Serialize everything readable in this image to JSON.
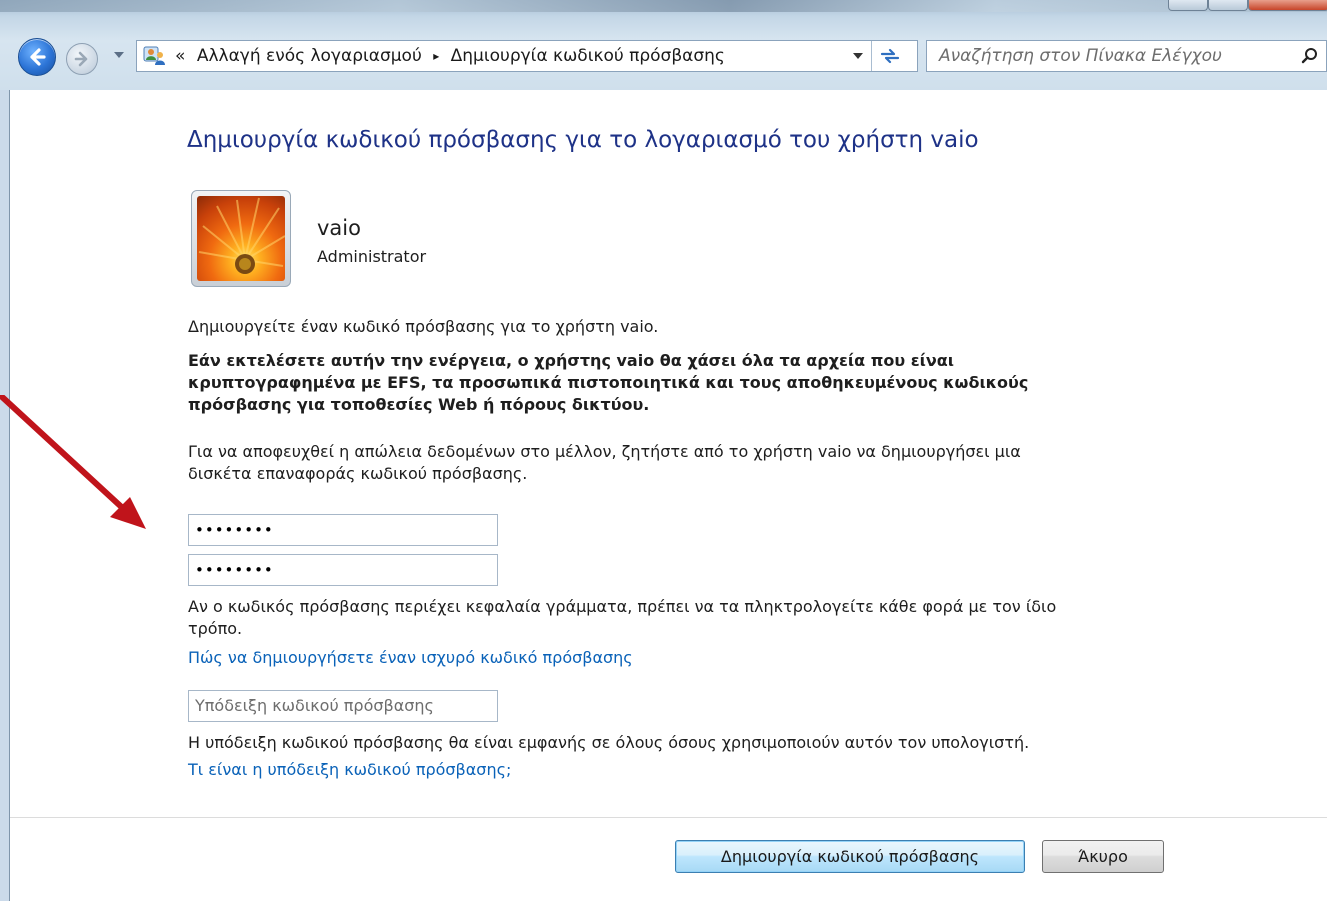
{
  "toolbar": {
    "breadcrumb": {
      "overflow": "«",
      "parent": "Αλλαγή ενός λογαριασμού",
      "separator": "▸",
      "current": "Δημιουργία κωδικού πρόσβασης"
    },
    "search_placeholder": "Αναζήτηση στον Πίνακα Ελέγχου"
  },
  "page": {
    "title": "Δημιουργία κωδικού πρόσβασης για το λογαριασμό του χρήστη vaio",
    "user": {
      "name": "vaio",
      "role": "Administrator"
    },
    "intro": "Δημιουργείτε έναν κωδικό πρόσβασης για το χρήστη vaio.",
    "warning_lines": [
      "Εάν εκτελέσετε αυτήν την ενέργεια, ο χρήστης vaio θα χάσει όλα τα αρχεία που είναι",
      "κρυπτογραφημένα με EFS, τα προσωπικά πιστοποιητικά και τους αποθηκευμένους κωδικούς",
      "πρόσβασης για τοποθεσίες Web ή πόρους δικτύου."
    ],
    "advice_lines": [
      "Για να αποφευχθεί η απώλεια δεδομένων στο μέλλον, ζητήστε από το χρήστη vaio να δημιουργήσει μια",
      "δισκέτα επαναφοράς κωδικού πρόσβασης."
    ],
    "password_value": "••••••••",
    "confirm_value": "••••••••",
    "case_note_lines": [
      "Αν ο κωδικός πρόσβασης περιέχει κεφαλαία γράμματα, πρέπει να τα πληκτρολογείτε κάθε φορά με τον ίδιο",
      "τρόπο."
    ],
    "strong_password_link": "Πώς να δημιουργήσετε έναν ισχυρό κωδικό πρόσβασης",
    "hint_placeholder": "Υπόδειξη κωδικού πρόσβασης",
    "hint_note": "Η υπόδειξη κωδικού πρόσβασης θα είναι εμφανής σε όλους όσους χρησιμοποιούν αυτόν τον υπολογιστή.",
    "hint_link": "Τι είναι η υπόδειξη κωδικού πρόσβασης;",
    "create_button": "Δημιουργία κωδικού πρόσβασης",
    "cancel_button": "Άκυρο"
  },
  "colors": {
    "title": "#1e3287",
    "link": "#0a62b8",
    "annotation_arrow": "#c0141b"
  },
  "icons": {
    "back": "back-arrow-icon",
    "forward": "forward-arrow-icon",
    "control_panel": "users-control-panel-icon",
    "refresh": "refresh-icon",
    "search": "search-icon"
  }
}
